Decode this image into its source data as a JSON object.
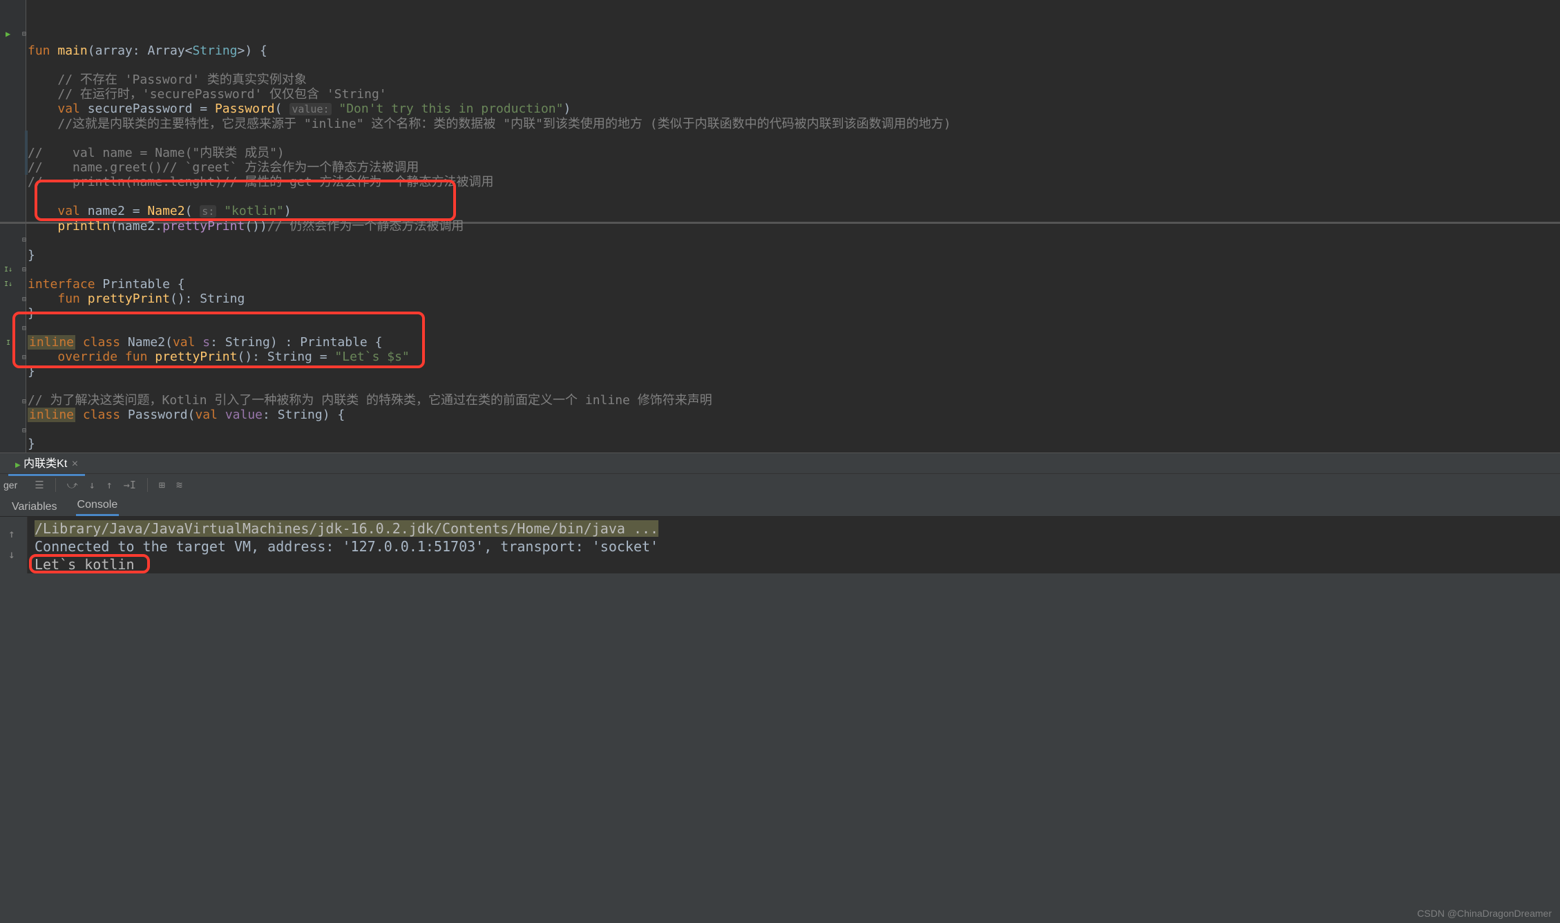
{
  "editor": {
    "line_fun": "fun",
    "line_main": "main",
    "line_array_param": "array",
    "line_array_type1": "Array",
    "line_string_type": "String",
    "brace_open": "{",
    "brace_close": "}",
    "comment1": "// 不存在 'Password' 类的真实实例对象",
    "comment2": "// 在运行时，'securePassword' 仅仅包含 'String'",
    "val_kw": "val",
    "securepwd": "securePassword",
    "eq": " = ",
    "password_fn": "Password",
    "value_hint": "value:",
    "pwd_str": "\"Don't try this in production\"",
    "comment3": "//这就是内联类的主要特性，它灵感来源于 \"inline\" 这个名称：类的数据被 \"内联\"到该类使用的地方 (类似于内联函数中的代码被内联到该函数调用的地方)",
    "cm_line1": "//    val name = Name(\"内联类 成员\")",
    "cm_line2": "//    name.greet()// `greet` 方法会作为一个静态方法被调用",
    "cm_line3": "//    println(name.lenght)// 属性的 get 方法会作为一个静态方法被调用",
    "name2_var": "name2",
    "name2_fn": "Name2",
    "s_hint": "s:",
    "kotlin_str": "\"kotlin\"",
    "println_fn": "println",
    "prettyprint_call": "prettyPrint",
    "comment4": "// 仍然会作为一个静态方法被调用",
    "interface_kw": "interface",
    "printable": "Printable",
    "fun_kw": "fun",
    "prettyprint_decl": "prettyPrint",
    "string_ret": "String",
    "inline_kw": "inline",
    "class_kw": "class",
    "name2_class": "Name2",
    "val_s": "val",
    "s_param": "s",
    "string_type2": "String",
    "colon_printable": " : Printable {",
    "override_kw": "override",
    "pretty_ret_str": "\"Let`s $s\"",
    "comment5": "// 为了解决这类问题，Kotlin 引入了一种被称为 内联类 的特殊类，它通过在类的前面定义一个 inline 修饰符来声明",
    "password_class": "Password",
    "value_param": "value"
  },
  "debug": {
    "tab_name": "内联类Kt",
    "toolbar_label": "ger",
    "subtab_variables": "Variables",
    "subtab_console": "Console",
    "console_line1": "/Library/Java/JavaVirtualMachines/jdk-16.0.2.jdk/Contents/Home/bin/java ...",
    "console_line2": "Connected to the target VM, address: '127.0.0.1:51703', transport: 'socket'",
    "console_output": "Let`s kotlin"
  },
  "watermark": "CSDN @ChinaDragonDreamer"
}
